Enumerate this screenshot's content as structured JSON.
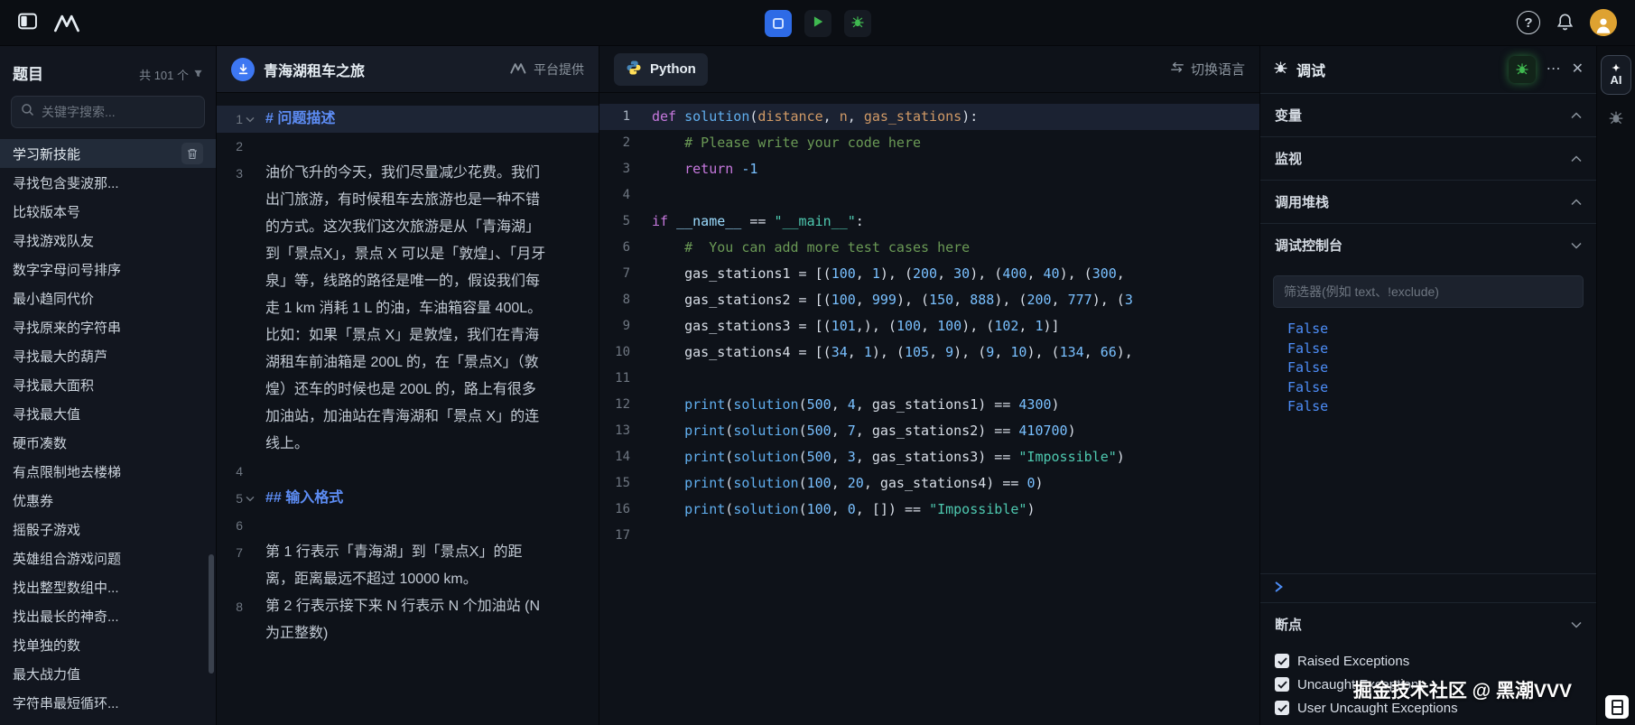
{
  "colors": {
    "accent_blue": "#4d8df7",
    "accent_green": "#3fb950",
    "heading_blue": "#5d8df5",
    "console_blue": "#4d8df7"
  },
  "topbar": {
    "action_icons": [
      "square-icon",
      "play-icon",
      "bug-icon"
    ],
    "right_icons": [
      "help-icon",
      "bell-icon",
      "avatar"
    ]
  },
  "problem_list": {
    "title": "题目",
    "count": "共 101 个",
    "search_placeholder": "关键字搜索...",
    "items": [
      {
        "label": "学习新技能",
        "selected": true
      },
      {
        "label": "寻找包含斐波那..."
      },
      {
        "label": "比较版本号"
      },
      {
        "label": "寻找游戏队友"
      },
      {
        "label": "数字字母问号排序"
      },
      {
        "label": "最小趋同代价"
      },
      {
        "label": "寻找原来的字符串"
      },
      {
        "label": "寻找最大的葫芦"
      },
      {
        "label": "寻找最大面积"
      },
      {
        "label": "寻找最大值"
      },
      {
        "label": "硬币凑数"
      },
      {
        "label": "有点限制地去楼梯"
      },
      {
        "label": "优惠券"
      },
      {
        "label": "摇骰子游戏"
      },
      {
        "label": "英雄组合游戏问题"
      },
      {
        "label": "找出整型数组中..."
      },
      {
        "label": "找出最长的神奇..."
      },
      {
        "label": "找单独的数"
      },
      {
        "label": "最大战力值"
      },
      {
        "label": "字符串最短循环..."
      }
    ]
  },
  "problem_panel": {
    "title": "青海湖租车之旅",
    "provider": "平台提供",
    "lines": [
      {
        "num": "1",
        "type": "h1",
        "text": "# 问题描述",
        "fold": true,
        "highlight": true
      },
      {
        "num": "2",
        "type": "blank",
        "text": ""
      },
      {
        "num": "3",
        "type": "p",
        "text": "油价飞升的今天，我们尽量减少花费。我们出门旅游，有时候租车去旅游也是一种不错的方式。这次我们这次旅游是从「青海湖」到「景点X」，景点 X 可以是「敦煌」、「月牙泉」等，线路的路径是唯一的，假设我们每走 1 km 消耗 1 L 的油，车油箱容量 400L。比如：如果「景点 X」是敦煌，我们在青海湖租车前油箱是 200L 的，在「景点X」（敦煌）还车的时候也是 200L 的，路上有很多加油站，加油站在青海湖和「景点 X」的连线上。"
      },
      {
        "num": "4",
        "type": "blank",
        "text": ""
      },
      {
        "num": "5",
        "type": "h2",
        "text": "## 输入格式",
        "fold": true
      },
      {
        "num": "6",
        "type": "blank",
        "text": ""
      },
      {
        "num": "7",
        "type": "p",
        "text": "第 1 行表示「青海湖」到「景点X」的距离，距离最远不超过 10000 km。"
      },
      {
        "num": "8",
        "type": "p",
        "text": "第 2 行表示接下来 N 行表示 N 个加油站 (N 为正整数)"
      }
    ]
  },
  "editor": {
    "language": "Python",
    "switch_label": "切换语言",
    "lines": [
      {
        "hl": true,
        "tokens": [
          [
            "kw",
            "def"
          ],
          [
            "pl",
            " "
          ],
          [
            "fn",
            "solution"
          ],
          [
            "pl",
            "("
          ],
          [
            "pr",
            "distance"
          ],
          [
            "pl",
            ", "
          ],
          [
            "pr",
            "n"
          ],
          [
            "pl",
            ", "
          ],
          [
            "pr",
            "gas_stations"
          ],
          [
            "pl",
            "):"
          ]
        ]
      },
      {
        "tokens": [
          [
            "pl",
            "    "
          ],
          [
            "cm",
            "# Please write your code here"
          ]
        ]
      },
      {
        "tokens": [
          [
            "pl",
            "    "
          ],
          [
            "kw",
            "return"
          ],
          [
            "pl",
            " "
          ],
          [
            "nm",
            "-1"
          ]
        ]
      },
      {
        "tokens": []
      },
      {
        "tokens": [
          [
            "kw",
            "if"
          ],
          [
            "pl",
            " "
          ],
          [
            "sp",
            "__name__"
          ],
          [
            "pl",
            " == "
          ],
          [
            "st",
            "\"__main__\""
          ],
          [
            "pl",
            ":"
          ]
        ]
      },
      {
        "tokens": [
          [
            "pl",
            "    "
          ],
          [
            "cm",
            "#  You can add more test cases here"
          ]
        ]
      },
      {
        "tokens": [
          [
            "pl",
            "    gas_stations1 = [("
          ],
          [
            "nm",
            "100"
          ],
          [
            "pl",
            ", "
          ],
          [
            "nm",
            "1"
          ],
          [
            "pl",
            "), ("
          ],
          [
            "nm",
            "200"
          ],
          [
            "pl",
            ", "
          ],
          [
            "nm",
            "30"
          ],
          [
            "pl",
            "), ("
          ],
          [
            "nm",
            "400"
          ],
          [
            "pl",
            ", "
          ],
          [
            "nm",
            "40"
          ],
          [
            "pl",
            "), ("
          ],
          [
            "nm",
            "300"
          ],
          [
            "pl",
            ","
          ]
        ]
      },
      {
        "tokens": [
          [
            "pl",
            "    gas_stations2 = [("
          ],
          [
            "nm",
            "100"
          ],
          [
            "pl",
            ", "
          ],
          [
            "nm",
            "999"
          ],
          [
            "pl",
            "), ("
          ],
          [
            "nm",
            "150"
          ],
          [
            "pl",
            ", "
          ],
          [
            "nm",
            "888"
          ],
          [
            "pl",
            "), ("
          ],
          [
            "nm",
            "200"
          ],
          [
            "pl",
            ", "
          ],
          [
            "nm",
            "777"
          ],
          [
            "pl",
            "), ("
          ],
          [
            "nm",
            "3"
          ]
        ]
      },
      {
        "tokens": [
          [
            "pl",
            "    gas_stations3 = [("
          ],
          [
            "nm",
            "101"
          ],
          [
            "pl",
            ",), ("
          ],
          [
            "nm",
            "100"
          ],
          [
            "pl",
            ", "
          ],
          [
            "nm",
            "100"
          ],
          [
            "pl",
            "), ("
          ],
          [
            "nm",
            "102"
          ],
          [
            "pl",
            ", "
          ],
          [
            "nm",
            "1"
          ],
          [
            "pl",
            ")]"
          ]
        ]
      },
      {
        "tokens": [
          [
            "pl",
            "    gas_stations4 = [("
          ],
          [
            "nm",
            "34"
          ],
          [
            "pl",
            ", "
          ],
          [
            "nm",
            "1"
          ],
          [
            "pl",
            "), ("
          ],
          [
            "nm",
            "105"
          ],
          [
            "pl",
            ", "
          ],
          [
            "nm",
            "9"
          ],
          [
            "pl",
            "), ("
          ],
          [
            "nm",
            "9"
          ],
          [
            "pl",
            ", "
          ],
          [
            "nm",
            "10"
          ],
          [
            "pl",
            "), ("
          ],
          [
            "nm",
            "134"
          ],
          [
            "pl",
            ", "
          ],
          [
            "nm",
            "66"
          ],
          [
            "pl",
            "),"
          ]
        ]
      },
      {
        "tokens": []
      },
      {
        "tokens": [
          [
            "pl",
            "    "
          ],
          [
            "fn",
            "print"
          ],
          [
            "pl",
            "("
          ],
          [
            "fn",
            "solution"
          ],
          [
            "pl",
            "("
          ],
          [
            "nm",
            "500"
          ],
          [
            "pl",
            ", "
          ],
          [
            "nm",
            "4"
          ],
          [
            "pl",
            ", gas_stations1) == "
          ],
          [
            "nm",
            "4300"
          ],
          [
            "pl",
            ")"
          ]
        ]
      },
      {
        "tokens": [
          [
            "pl",
            "    "
          ],
          [
            "fn",
            "print"
          ],
          [
            "pl",
            "("
          ],
          [
            "fn",
            "solution"
          ],
          [
            "pl",
            "("
          ],
          [
            "nm",
            "500"
          ],
          [
            "pl",
            ", "
          ],
          [
            "nm",
            "7"
          ],
          [
            "pl",
            ", gas_stations2) == "
          ],
          [
            "nm",
            "410700"
          ],
          [
            "pl",
            ")"
          ]
        ]
      },
      {
        "tokens": [
          [
            "pl",
            "    "
          ],
          [
            "fn",
            "print"
          ],
          [
            "pl",
            "("
          ],
          [
            "fn",
            "solution"
          ],
          [
            "pl",
            "("
          ],
          [
            "nm",
            "500"
          ],
          [
            "pl",
            ", "
          ],
          [
            "nm",
            "3"
          ],
          [
            "pl",
            ", gas_stations3) == "
          ],
          [
            "st",
            "\"Impossible\""
          ],
          [
            "pl",
            ")"
          ]
        ]
      },
      {
        "tokens": [
          [
            "pl",
            "    "
          ],
          [
            "fn",
            "print"
          ],
          [
            "pl",
            "("
          ],
          [
            "fn",
            "solution"
          ],
          [
            "pl",
            "("
          ],
          [
            "nm",
            "100"
          ],
          [
            "pl",
            ", "
          ],
          [
            "nm",
            "20"
          ],
          [
            "pl",
            ", gas_stations4) == "
          ],
          [
            "nm",
            "0"
          ],
          [
            "pl",
            ")"
          ]
        ]
      },
      {
        "tokens": [
          [
            "pl",
            "    "
          ],
          [
            "fn",
            "print"
          ],
          [
            "pl",
            "("
          ],
          [
            "fn",
            "solution"
          ],
          [
            "pl",
            "("
          ],
          [
            "nm",
            "100"
          ],
          [
            "pl",
            ", "
          ],
          [
            "nm",
            "0"
          ],
          [
            "pl",
            ", []) == "
          ],
          [
            "st",
            "\"Impossible\""
          ],
          [
            "pl",
            ")"
          ]
        ]
      },
      {
        "tokens": []
      }
    ]
  },
  "debug_panel": {
    "title": "调试",
    "sections": [
      {
        "label": "变量",
        "state": "collapsed"
      },
      {
        "label": "监视",
        "state": "collapsed"
      },
      {
        "label": "调用堆栈",
        "state": "collapsed"
      },
      {
        "label": "调试控制台",
        "state": "expanded"
      }
    ],
    "filter_placeholder": "筛选器(例如 text、!exclude)",
    "console_output": [
      "False",
      "False",
      "False",
      "False",
      "False"
    ],
    "breakpoints_label": "断点",
    "breakpoints": [
      {
        "label": "Raised Exceptions",
        "checked": true
      },
      {
        "label": "Uncaught Exceptions",
        "checked": true
      },
      {
        "label": "User Uncaught Exceptions",
        "checked": true
      }
    ]
  },
  "right_rail": {
    "ai_label": "AI"
  },
  "watermark": {
    "text": "掘金技术社区 @ 黑潮VVV"
  }
}
